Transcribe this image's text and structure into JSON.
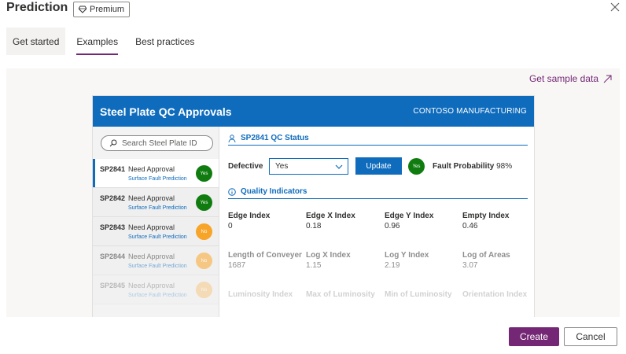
{
  "header": {
    "title": "Prediction",
    "badge": "Premium"
  },
  "tabs": [
    {
      "label": "Get started"
    },
    {
      "label": "Examples"
    },
    {
      "label": "Best practices"
    }
  ],
  "preview": {
    "sample_link": "Get sample data",
    "app": {
      "title": "Steel Plate QC Approvals",
      "company": "CONTOSO MANUFACTURING",
      "search_placeholder": "Search Steel Plate ID",
      "items": [
        {
          "id": "SP2841",
          "status": "Need Approval",
          "sub": "Surface Fault Prediction",
          "badge": "Yes"
        },
        {
          "id": "SP2842",
          "status": "Need Approval",
          "sub": "Surface Fault Prediction",
          "badge": "Yes"
        },
        {
          "id": "SP2843",
          "status": "Need Approval",
          "sub": "Surface Fault Prediction",
          "badge": "No"
        },
        {
          "id": "SP2844",
          "status": "Need Approval",
          "sub": "Surface Fault Prediction",
          "badge": "No"
        },
        {
          "id": "SP2845",
          "status": "Need Approval",
          "sub": "Surface Fault Prediction",
          "badge": "No"
        }
      ],
      "status_section": "SP2841 QC Status",
      "defective_label": "Defective",
      "defective_value": "Yes",
      "update_label": "Update",
      "fault_badge": "Yes",
      "fault_label": "Fault Probability",
      "fault_value": "98%",
      "quality_section": "Quality Indicators",
      "indicators": [
        {
          "name": "Edge Index",
          "value": "0"
        },
        {
          "name": "Edge X Index",
          "value": "0.18"
        },
        {
          "name": "Edge Y Index",
          "value": "0.96"
        },
        {
          "name": "Empty Index",
          "value": "0.46"
        },
        {
          "name": "Length of Conveyer",
          "value": "1687"
        },
        {
          "name": "Log X Index",
          "value": "1.15"
        },
        {
          "name": "Log Y Index",
          "value": "2.19"
        },
        {
          "name": "Log of Areas",
          "value": "3.07"
        },
        {
          "name": "Luminosity Index",
          "value": ""
        },
        {
          "name": "Max of Luminosity",
          "value": ""
        },
        {
          "name": "Min of Luminosity",
          "value": ""
        },
        {
          "name": "Orientation Index",
          "value": ""
        }
      ]
    }
  },
  "footer": {
    "create": "Create",
    "cancel": "Cancel"
  },
  "colors": {
    "accent": "#742774",
    "app_blue": "#0f6cbd",
    "yes_green": "#107c10",
    "no_orange": "#f7a428"
  }
}
